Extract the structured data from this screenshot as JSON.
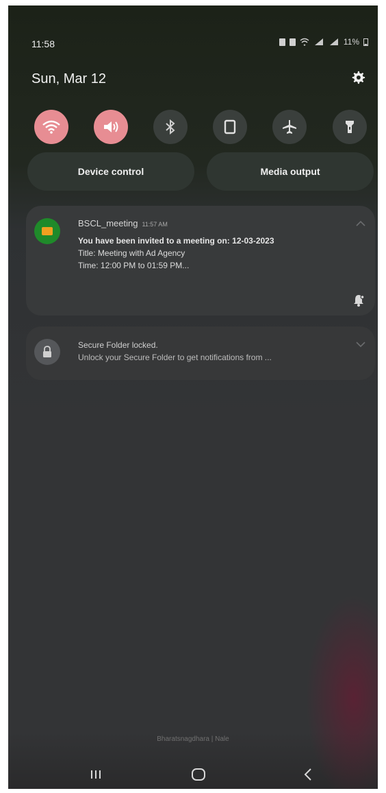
{
  "status": {
    "time": "11:58",
    "battery": "11%"
  },
  "header": {
    "date": "Sun, Mar 12"
  },
  "quick_settings": [
    {
      "name": "wifi",
      "active": true,
      "icon": "wifi-icon"
    },
    {
      "name": "sound",
      "active": true,
      "icon": "sound-icon"
    },
    {
      "name": "bluetooth",
      "active": false,
      "icon": "bluetooth-icon"
    },
    {
      "name": "portrait",
      "active": false,
      "icon": "portrait-icon"
    },
    {
      "name": "airplane",
      "active": false,
      "icon": "airplane-icon"
    },
    {
      "name": "flashlight",
      "active": false,
      "icon": "flashlight-icon"
    }
  ],
  "buttons": {
    "device_control": "Device control",
    "media_output": "Media output"
  },
  "notifications": [
    {
      "app": "BSCL_meeting",
      "time": "11:57 AM",
      "line1": "You have been invited to a meeting on: 12-03-2023",
      "line2": "Title: Meeting with Ad Agency",
      "line3": "Time: 12:00 PM to 01:59 PM..."
    },
    {
      "title": "Secure Folder locked.",
      "body": "Unlock your Secure Folder to get notifications from ..."
    }
  ],
  "footer": {
    "text": "Bharatsnagdhara | Nale"
  },
  "colors": {
    "active_tile": "#e78d93",
    "inactive_tile": "#3a3f3c"
  }
}
